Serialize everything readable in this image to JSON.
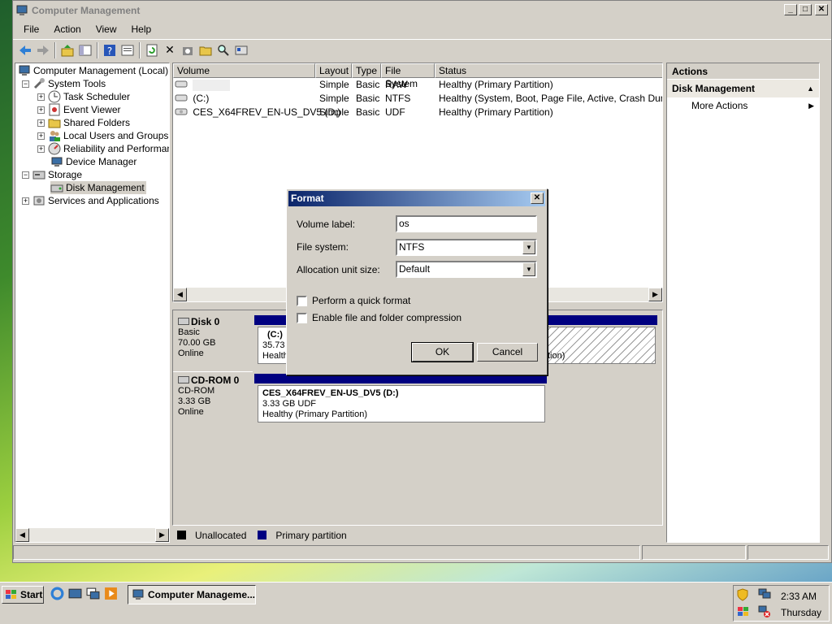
{
  "window": {
    "title": "Computer Management"
  },
  "menu": [
    "File",
    "Action",
    "View",
    "Help"
  ],
  "tree": {
    "root": "Computer Management (Local)",
    "system_tools": "System Tools",
    "task_scheduler": "Task Scheduler",
    "event_viewer": "Event Viewer",
    "shared_folders": "Shared Folders",
    "local_users": "Local Users and Groups",
    "reliability": "Reliability and Performanc",
    "device_manager": "Device Manager",
    "storage": "Storage",
    "disk_management": "Disk Management",
    "services": "Services and Applications"
  },
  "volumes": {
    "columns": [
      "Volume",
      "Layout",
      "Type",
      "File System",
      "Status"
    ],
    "rows": [
      {
        "volume": "",
        "layout": "Simple",
        "type": "Basic",
        "fs": "RAW",
        "status": "Healthy (Primary Partition)"
      },
      {
        "volume": "(C:)",
        "layout": "Simple",
        "type": "Basic",
        "fs": "NTFS",
        "status": "Healthy (System, Boot, Page File, Active, Crash Dump, Pr"
      },
      {
        "volume": "CES_X64FREV_EN-US_DV5 (D:)",
        "layout": "Simple",
        "type": "Basic",
        "fs": "UDF",
        "status": "Healthy (Primary Partition)"
      }
    ]
  },
  "disks": {
    "disk0": {
      "name": "Disk 0",
      "type": "Basic",
      "size": "70.00 GB",
      "state": "Online",
      "part_name": "(C:)",
      "part_size": "35.73",
      "part_status": "Health",
      "part2_status": "tion)"
    },
    "cdrom0": {
      "name": "CD-ROM 0",
      "type": "CD-ROM",
      "size": "3.33 GB",
      "state": "Online",
      "part_name": "CES_X64FREV_EN-US_DV5  (D:)",
      "part_size": "3.33 GB UDF",
      "part_status": "Healthy (Primary Partition)"
    }
  },
  "legend": {
    "unallocated": "Unallocated",
    "primary": "Primary partition"
  },
  "actions": {
    "header": "Actions",
    "section": "Disk Management",
    "more": "More Actions"
  },
  "dialog": {
    "title": "Format",
    "volume_label": "Volume label:",
    "volume_value": "os",
    "file_system": "File system:",
    "file_system_value": "NTFS",
    "alloc": "Allocation unit size:",
    "alloc_value": "Default",
    "quick_format": "Perform a quick format",
    "compression": "Enable file and folder compression",
    "ok": "OK",
    "cancel": "Cancel"
  },
  "taskbar": {
    "start": "Start",
    "task": "Computer Manageme...",
    "time": "2:33 AM",
    "day": "Thursday"
  },
  "colors": {
    "primary_partition": "#000080",
    "dialog_title": "#0a246a"
  }
}
